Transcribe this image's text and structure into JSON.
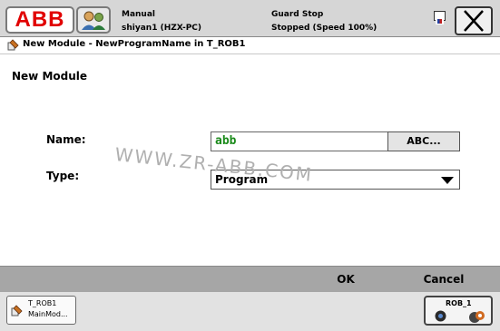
{
  "top_bar": {
    "logo_text": "ABB",
    "mode": "Manual",
    "station": "shiyan1 (HZX-PC)",
    "guard_state": "Guard Stop",
    "run_state": "Stopped (Speed 100%)"
  },
  "window": {
    "title": "New Module - NewProgramName in T_ROB1"
  },
  "form": {
    "heading": "New Module",
    "name_label": "Name:",
    "name_value": "abb",
    "keyboard_button": "ABC...",
    "type_label": "Type:",
    "type_value": "Program"
  },
  "watermark": "WWW.ZR-ABB.COM",
  "command_bar": {
    "ok_label": "OK",
    "cancel_label": "Cancel"
  },
  "task_bar": {
    "task_line1": "T_ROB1",
    "task_line2": "MainMod...",
    "quickset_label": "ROB_1"
  },
  "colors": {
    "brand_red": "#e10000",
    "name_text": "#1a8a1a",
    "command_bar": "#a6a6a6"
  }
}
